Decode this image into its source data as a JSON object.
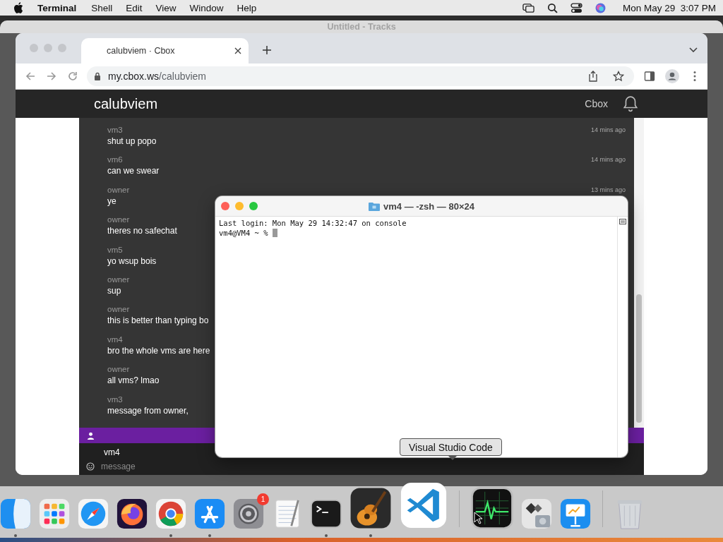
{
  "menubar": {
    "app": "Terminal",
    "menus": [
      "Shell",
      "Edit",
      "View",
      "Window",
      "Help"
    ],
    "clock": "Mon May 29  3:07 PM"
  },
  "background_window": {
    "title": "Untitled - Tracks"
  },
  "browser": {
    "tab": {
      "title": "calubviem · Cbox",
      "selected": true
    },
    "url_host": "my.cbox.ws",
    "url_path": "/calubviem"
  },
  "page": {
    "header_title": "calubviem",
    "header_link": "Cbox",
    "messages": [
      {
        "user": "vm3",
        "text": "shut up popo",
        "time": "14 mins ago"
      },
      {
        "user": "vm6",
        "text": "can we swear",
        "time": "14 mins ago"
      },
      {
        "user": "owner",
        "text": "ye",
        "time": "13 mins ago"
      },
      {
        "user": "owner",
        "text": "theres no safechat"
      },
      {
        "user": "vm5",
        "text": "yo wsup bois"
      },
      {
        "user": "owner",
        "text": "sup"
      },
      {
        "user": "owner",
        "text": "this is better than typing bo"
      },
      {
        "user": "vm4",
        "text": "bro the whole vms are here"
      },
      {
        "user": "owner",
        "text": "all vms? lmao"
      },
      {
        "user": "vm3",
        "text": "message from owner,"
      }
    ],
    "input": {
      "name": "vm4",
      "placeholder": "message"
    }
  },
  "terminal": {
    "title": "vm4 — -zsh — 80×24",
    "lines": [
      "Last login: Mon May 29 14:32:47 on console",
      "vm4@VM4 ~ %"
    ]
  },
  "tooltip": "Visual Studio Code",
  "dock": {
    "apps": [
      {
        "kind": "finder",
        "running": true,
        "hovered": false
      },
      {
        "kind": "launchpad",
        "running": false,
        "hovered": false
      },
      {
        "kind": "safari",
        "running": false,
        "hovered": false
      },
      {
        "kind": "firefox",
        "running": false,
        "hovered": false
      },
      {
        "kind": "chrome",
        "running": true,
        "hovered": false
      },
      {
        "kind": "appstore",
        "running": true,
        "hovered": false
      },
      {
        "kind": "settings",
        "running": false,
        "hovered": false,
        "badge": "1"
      },
      {
        "kind": "textedit",
        "running": false,
        "hovered": false
      },
      {
        "kind": "terminal",
        "running": true,
        "hovered": false
      },
      {
        "kind": "garageband",
        "running": true,
        "hovered": false
      },
      {
        "kind": "vscode",
        "running": false,
        "hovered": true
      }
    ],
    "utilities": [
      {
        "kind": "activity",
        "running": false,
        "hovered": false
      },
      {
        "kind": "bootcamp",
        "running": false,
        "hovered": false
      },
      {
        "kind": "keynote",
        "running": false,
        "hovered": false
      }
    ],
    "trash": {
      "kind": "trash",
      "running": false,
      "hovered": false
    }
  }
}
